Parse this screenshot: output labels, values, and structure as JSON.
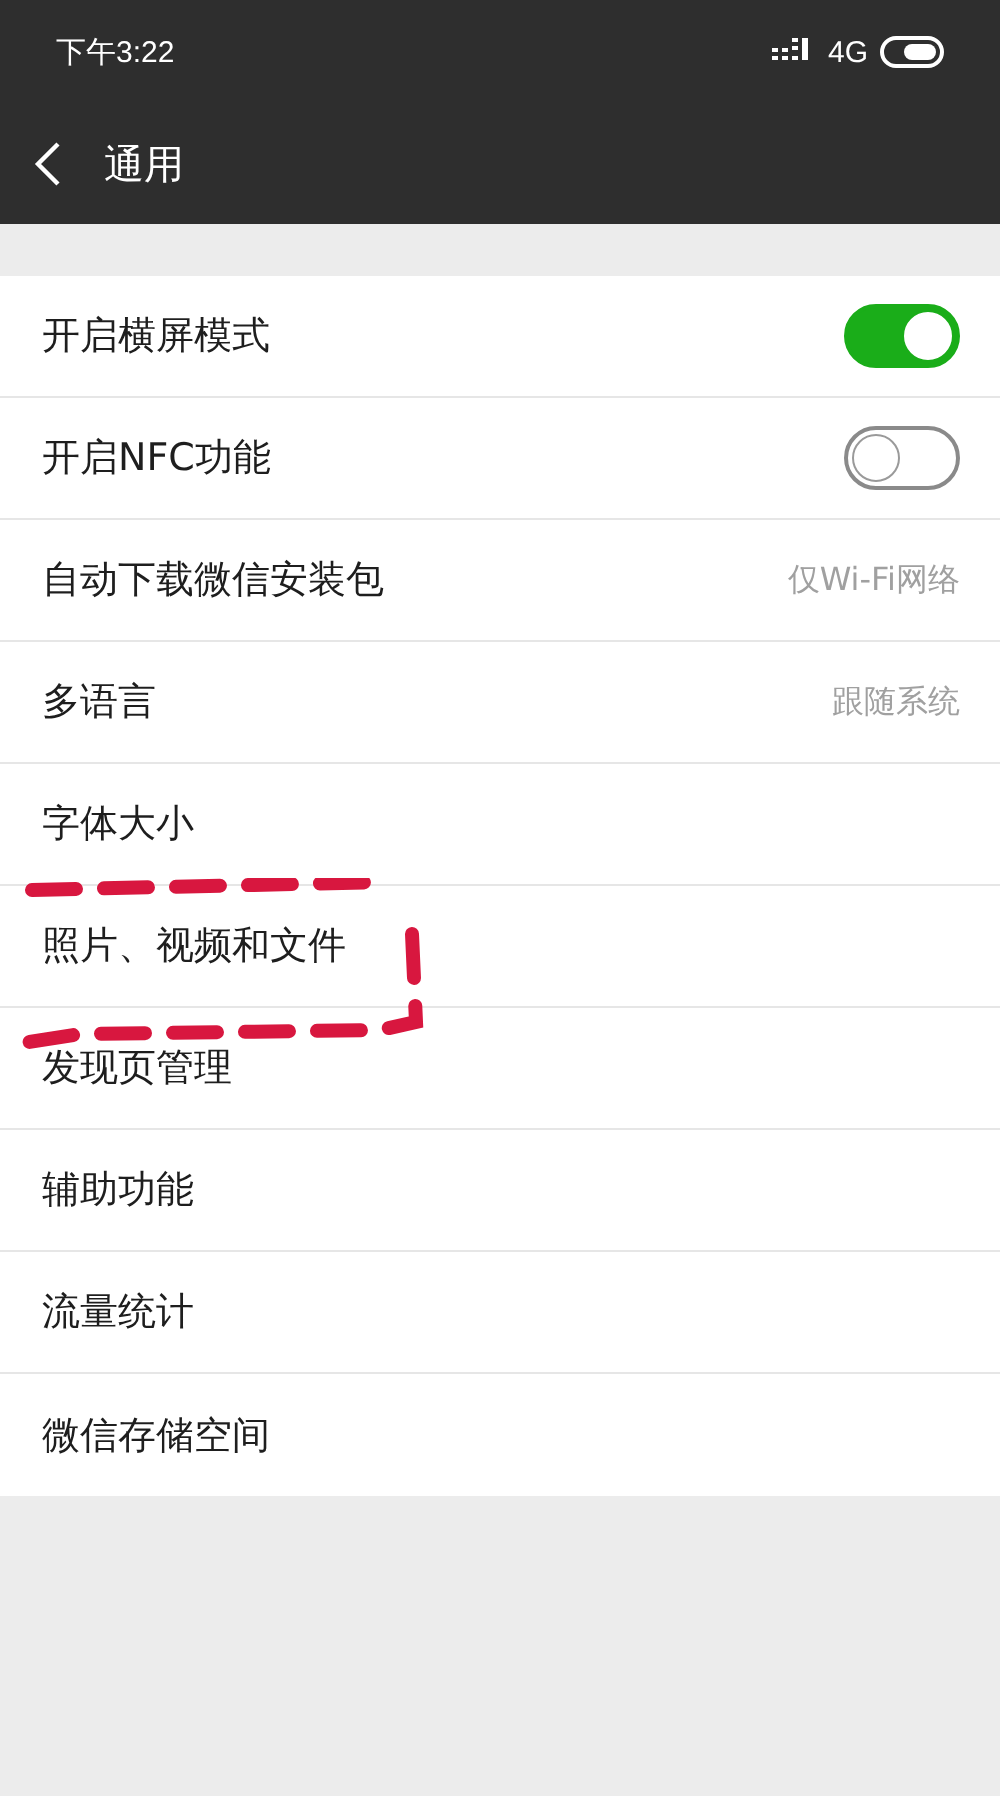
{
  "status_bar": {
    "time": "下午3:22",
    "network": "4G"
  },
  "header": {
    "title": "通用"
  },
  "items": [
    {
      "kind": "toggle",
      "label": "开启横屏模式",
      "on": true,
      "highlighted": false
    },
    {
      "kind": "toggle",
      "label": "开启NFC功能",
      "on": false,
      "highlighted": false
    },
    {
      "kind": "value",
      "label": "自动下载微信安装包",
      "value": "仅Wi-Fi网络",
      "highlighted": false
    },
    {
      "kind": "value",
      "label": "多语言",
      "value": "跟随系统",
      "highlighted": false
    },
    {
      "kind": "plain",
      "label": "字体大小",
      "highlighted": false
    },
    {
      "kind": "plain",
      "label": "照片、视频和文件",
      "highlighted": true
    },
    {
      "kind": "plain",
      "label": "发现页管理",
      "highlighted": false
    },
    {
      "kind": "plain",
      "label": "辅助功能",
      "highlighted": false
    },
    {
      "kind": "plain",
      "label": "流量统计",
      "highlighted": false
    },
    {
      "kind": "plain",
      "label": "微信存储空间",
      "highlighted": false
    }
  ]
}
